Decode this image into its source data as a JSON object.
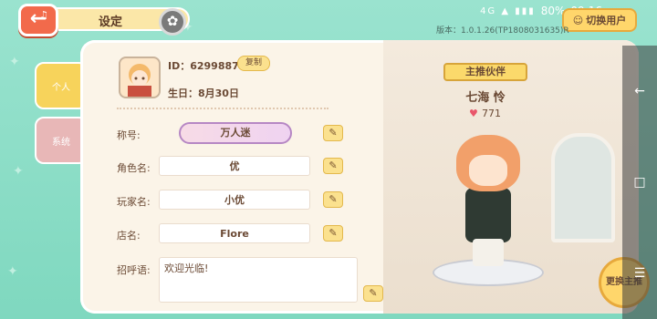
{
  "status_bar": {
    "battery": "80%",
    "time": "09:16",
    "signal_icons": "4G ▲ ▮▮▮"
  },
  "header": {
    "title": "设定",
    "switch_user_label": "切换用户",
    "version": "版本：1.0.1.26(TP1808031635)R"
  },
  "tabs": [
    {
      "label": "个人"
    },
    {
      "label": "系统"
    }
  ],
  "profile": {
    "id_text": "ID：62998873",
    "copy_label": "复制",
    "birthday": "生日：8月30日",
    "fields": [
      {
        "label": "称号:",
        "value": "万人迷"
      },
      {
        "label": "角色名:",
        "value": "优"
      },
      {
        "label": "玩家名:",
        "value": "小优"
      },
      {
        "label": "店名:",
        "value": "Flore"
      },
      {
        "label": "招呼语:",
        "value": "欢迎光临!"
      }
    ]
  },
  "partner": {
    "ribbon": "主推伙伴",
    "name": "七海 怜",
    "affection": "771"
  },
  "change_main_label": "更换主推",
  "icons": [
    "back-icon",
    "gear-icon",
    "edit-icon",
    "heart-icon",
    "nav-back-icon",
    "nav-home-icon",
    "nav-recent-icon"
  ],
  "colors": {
    "accent": "#f26a4b",
    "gold": "#fbd96b",
    "mint": "#8fdcc6"
  }
}
